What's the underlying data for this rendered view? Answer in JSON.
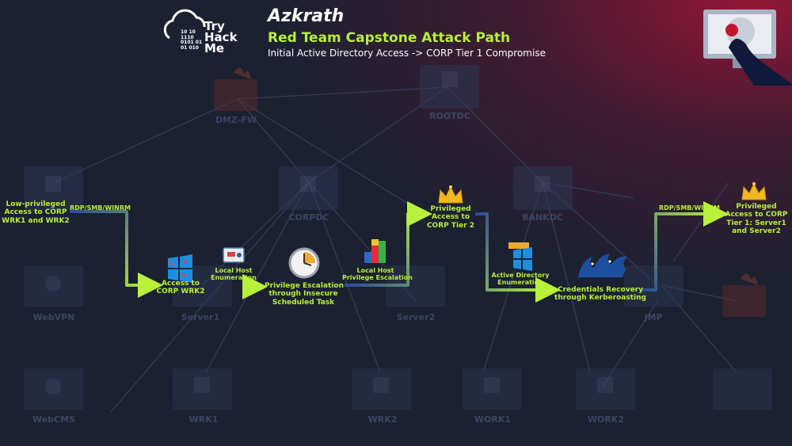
{
  "header": {
    "title": "Azkrath",
    "subtitle": "Red Team Capstone Attack Path",
    "caption": "Initial Active Directory Access -> CORP Tier 1 Compromise",
    "logo_line1": "Try",
    "logo_line2": "Hack",
    "logo_line3": "Me",
    "logo_binary": [
      "10 10",
      "1110",
      "0101 01",
      "01 010"
    ]
  },
  "background_nodes": {
    "dmz_fw": "DMZ-FW",
    "rootdc": "ROOTDC",
    "corpdc": "CORPDC",
    "bankdc": "BANKDC",
    "webvpn": "WebVPN",
    "server1": "Server1",
    "server2": "Server2",
    "jmp": "JMP",
    "webcms": "WebCMS",
    "wrk1": "WRK1",
    "wrk2": "WRK2",
    "work1": "WORK1",
    "work2": "WORK2"
  },
  "steps": {
    "start": [
      "Low-privileged",
      "Access to CORP",
      "WRK1 and WRK2"
    ],
    "edge_rdp_1": "RDP/SMB/WINRM",
    "access_wrk2": [
      "Access to",
      "CORP WRK2"
    ],
    "edge_enum": [
      "Local Host",
      "Enumeration"
    ],
    "privesc": [
      "Privilege Escalation",
      "through Insecure",
      "Scheduled Task"
    ],
    "edge_privesc": [
      "Local Host",
      "Privilege Escalation"
    ],
    "priv_tier2": [
      "Privileged",
      "Access to",
      "CORP Tier 2"
    ],
    "edge_ad_enum": [
      "Active Directory",
      "Enumeration"
    ],
    "creds": [
      "Credentials Recovery",
      "through Kerberoasting"
    ],
    "edge_rdp_2": "RDP/SMB/WINRM",
    "final": [
      "Privileged",
      "Access to CORP",
      "Tier 1:  Server1",
      "and  Server2"
    ]
  },
  "icons": {
    "logo": "cloud-logo-icon",
    "hacker": "hacker-monitor-icon",
    "crown": "crown-icon",
    "windows": "windows-logo-icon",
    "clock": "clock-icon",
    "blocks": "privilege-blocks-icon",
    "screen": "enumeration-screen-icon",
    "kerberos": "kerberos-cerberus-icon"
  },
  "colors": {
    "background": "#1b2131",
    "accent": "#b8f03a",
    "path_start": "#2a4a9a",
    "node_dim": "#2c3652",
    "glow": "#a3123c"
  }
}
